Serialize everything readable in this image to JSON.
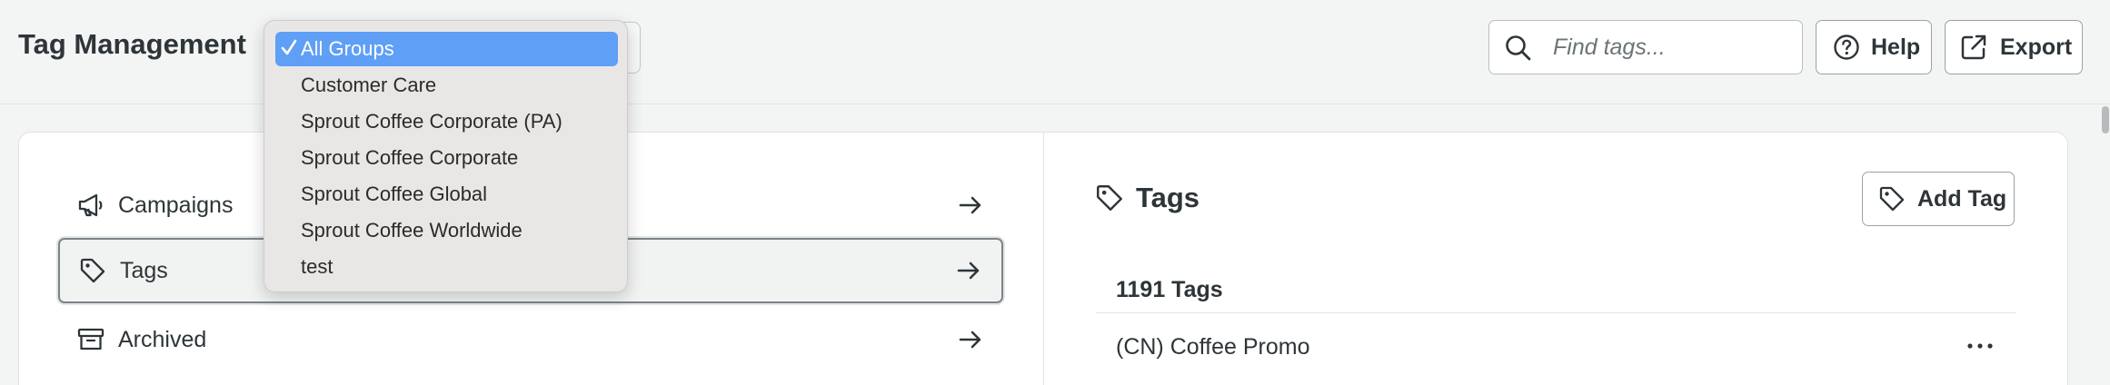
{
  "header": {
    "title": "Tag Management",
    "search": {
      "placeholder": "Find tags...",
      "value": ""
    },
    "help_label": "Help",
    "export_label": "Export"
  },
  "group_dropdown": {
    "selected": "All Groups",
    "options": [
      "All Groups",
      "Customer Care",
      "Sprout Coffee Corporate (PA)",
      "Sprout Coffee Corporate",
      "Sprout Coffee Global",
      "Sprout Coffee Worldwide",
      "test"
    ],
    "selected_color": "#5f9ff5"
  },
  "sidebar": {
    "items": [
      {
        "label": "Campaigns",
        "icon": "megaphone-icon"
      },
      {
        "label": "Tags",
        "icon": "tag-icon",
        "active": true
      },
      {
        "label": "Archived",
        "icon": "archive-box-icon"
      }
    ]
  },
  "tags_panel": {
    "title": "Tags",
    "add_label": "Add Tag",
    "count_label": "1191 Tags",
    "rows": [
      {
        "name": "(CN) Coffee Promo"
      }
    ]
  }
}
